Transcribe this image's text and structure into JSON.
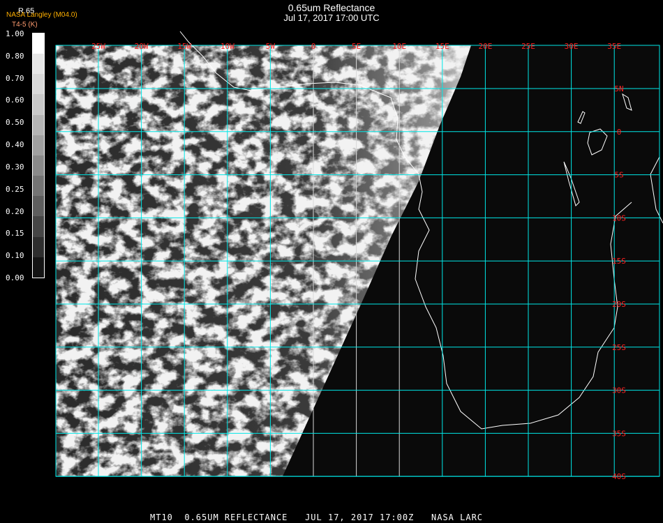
{
  "title": "0.65um Reflectance",
  "subtitle": "Jul 17, 2017 17:00 UTC",
  "credit": "NASA Langley (M04.0)",
  "product_label": "R.65",
  "secondary_label": "T4-5 (K)",
  "colorbar": {
    "ticks": [
      "1.00",
      "0.80",
      "0.70",
      "0.60",
      "0.50",
      "0.40",
      "0.30",
      "0.25",
      "0.20",
      "0.15",
      "0.10",
      "0.00"
    ],
    "shades": [
      "#ffffff",
      "#e6e6e6",
      "#d8d8d8",
      "#c8c8c8",
      "#b4b4b4",
      "#a0a0a0",
      "#8a8a8a",
      "#747474",
      "#5e5e5e",
      "#464646",
      "#2e2e2e",
      "#141414"
    ]
  },
  "map": {
    "lon_labels": [
      "25W",
      "20W",
      "15W",
      "10W",
      "5W",
      "0",
      "5E",
      "10E",
      "15E",
      "20E",
      "25E",
      "30E",
      "35E"
    ],
    "lat_labels": [
      "5N",
      "0",
      "5S",
      "10S",
      "15S",
      "20S",
      "25S",
      "30S",
      "35S",
      "40S"
    ],
    "grid_color": "#00e8e8",
    "label_color": "#ff2020"
  },
  "footer": "MT10  0.65UM REFLECTANCE   JUL 17, 2017 17:00Z   NASA LARC"
}
